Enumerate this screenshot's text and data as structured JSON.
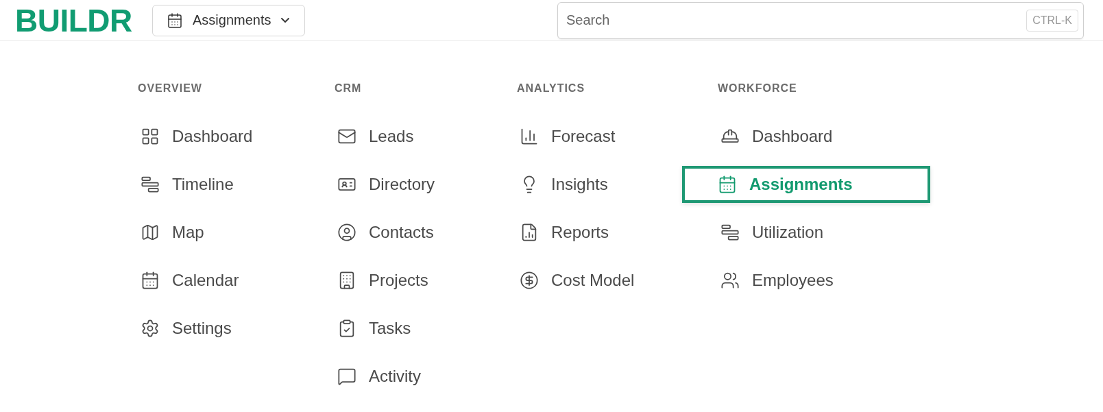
{
  "header": {
    "logo": "BUILDR",
    "page_switcher": {
      "label": "Assignments"
    },
    "search": {
      "placeholder": "Search",
      "shortcut": "CTRL-K"
    }
  },
  "menu": [
    {
      "heading": "OVERVIEW",
      "items": [
        {
          "label": "Dashboard",
          "selected": false
        },
        {
          "label": "Timeline",
          "selected": false
        },
        {
          "label": "Map",
          "selected": false
        },
        {
          "label": "Calendar",
          "selected": false
        },
        {
          "label": "Settings",
          "selected": false
        }
      ]
    },
    {
      "heading": "CRM",
      "items": [
        {
          "label": "Leads",
          "selected": false
        },
        {
          "label": "Directory",
          "selected": false
        },
        {
          "label": "Contacts",
          "selected": false
        },
        {
          "label": "Projects",
          "selected": false
        },
        {
          "label": "Tasks",
          "selected": false
        },
        {
          "label": "Activity",
          "selected": false
        }
      ]
    },
    {
      "heading": "ANALYTICS",
      "items": [
        {
          "label": "Forecast",
          "selected": false
        },
        {
          "label": "Insights",
          "selected": false
        },
        {
          "label": "Reports",
          "selected": false
        },
        {
          "label": "Cost Model",
          "selected": false
        }
      ]
    },
    {
      "heading": "WORKFORCE",
      "items": [
        {
          "label": "Dashboard",
          "selected": false
        },
        {
          "label": "Assignments",
          "selected": true
        },
        {
          "label": "Utilization",
          "selected": false
        },
        {
          "label": "Employees",
          "selected": false
        }
      ]
    }
  ]
}
